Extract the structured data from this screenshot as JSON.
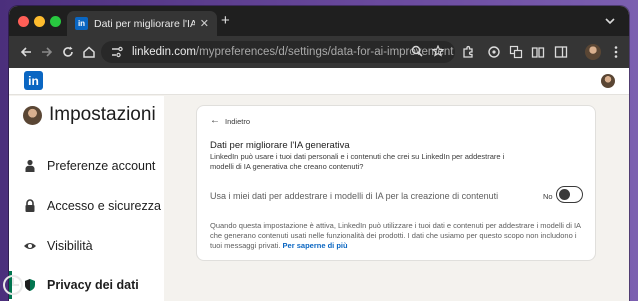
{
  "browser": {
    "tab_title": "Dati per migliorare l'IA generativa",
    "tab_favicon": "in",
    "url_host": "linkedin.com",
    "url_path": "/mypreferences/d/settings/data-for-ai-improvement",
    "icons": [
      "back-arrow-icon",
      "forward-arrow-icon",
      "reload-icon",
      "home-icon",
      "site-info-icon",
      "zoom-icon",
      "star-icon",
      "extensions-icon",
      "media-icon",
      "translate-icon",
      "reading-list-icon",
      "sidebar-icon",
      "menu-dots-icon"
    ]
  },
  "linkedin": {
    "logo": "in"
  },
  "sidebar": {
    "title": "Impostazioni",
    "items": [
      {
        "label": "Preferenze account",
        "icon": "person-icon",
        "active": false
      },
      {
        "label": "Accesso e sicurezza",
        "icon": "lock-icon",
        "active": false
      },
      {
        "label": "Visibilità",
        "icon": "eye-icon",
        "active": false
      },
      {
        "label": "Privacy dei dati",
        "icon": "shield-icon",
        "active": true
      }
    ]
  },
  "card": {
    "back_label": "Indietro",
    "title": "Dati per migliorare l'IA generativa",
    "description": "LinkedIn può usare i tuoi dati personali e i contenuti che crei su LinkedIn per addestrare i modelli di IA generativa che creano contenuti?",
    "setting_label": "Usa i miei dati per addestrare i modelli di IA per la creazione di contenuti",
    "toggle_state": "No",
    "toggle_on": false,
    "footnote": "Quando questa impostazione è attiva, LinkedIn può utilizzare i tuoi dati e contenuti per addestrare i modelli di IA che generano contenuti usati nelle funzionalità dei prodotti. I dati che usiamo per questo scopo non includono i tuoi messaggi privati.",
    "footnote_link": "Per saperne di più"
  },
  "colors": {
    "linkedin_blue": "#0a66c2",
    "active_green": "#01754f",
    "page_bg": "#f4f2ee"
  }
}
